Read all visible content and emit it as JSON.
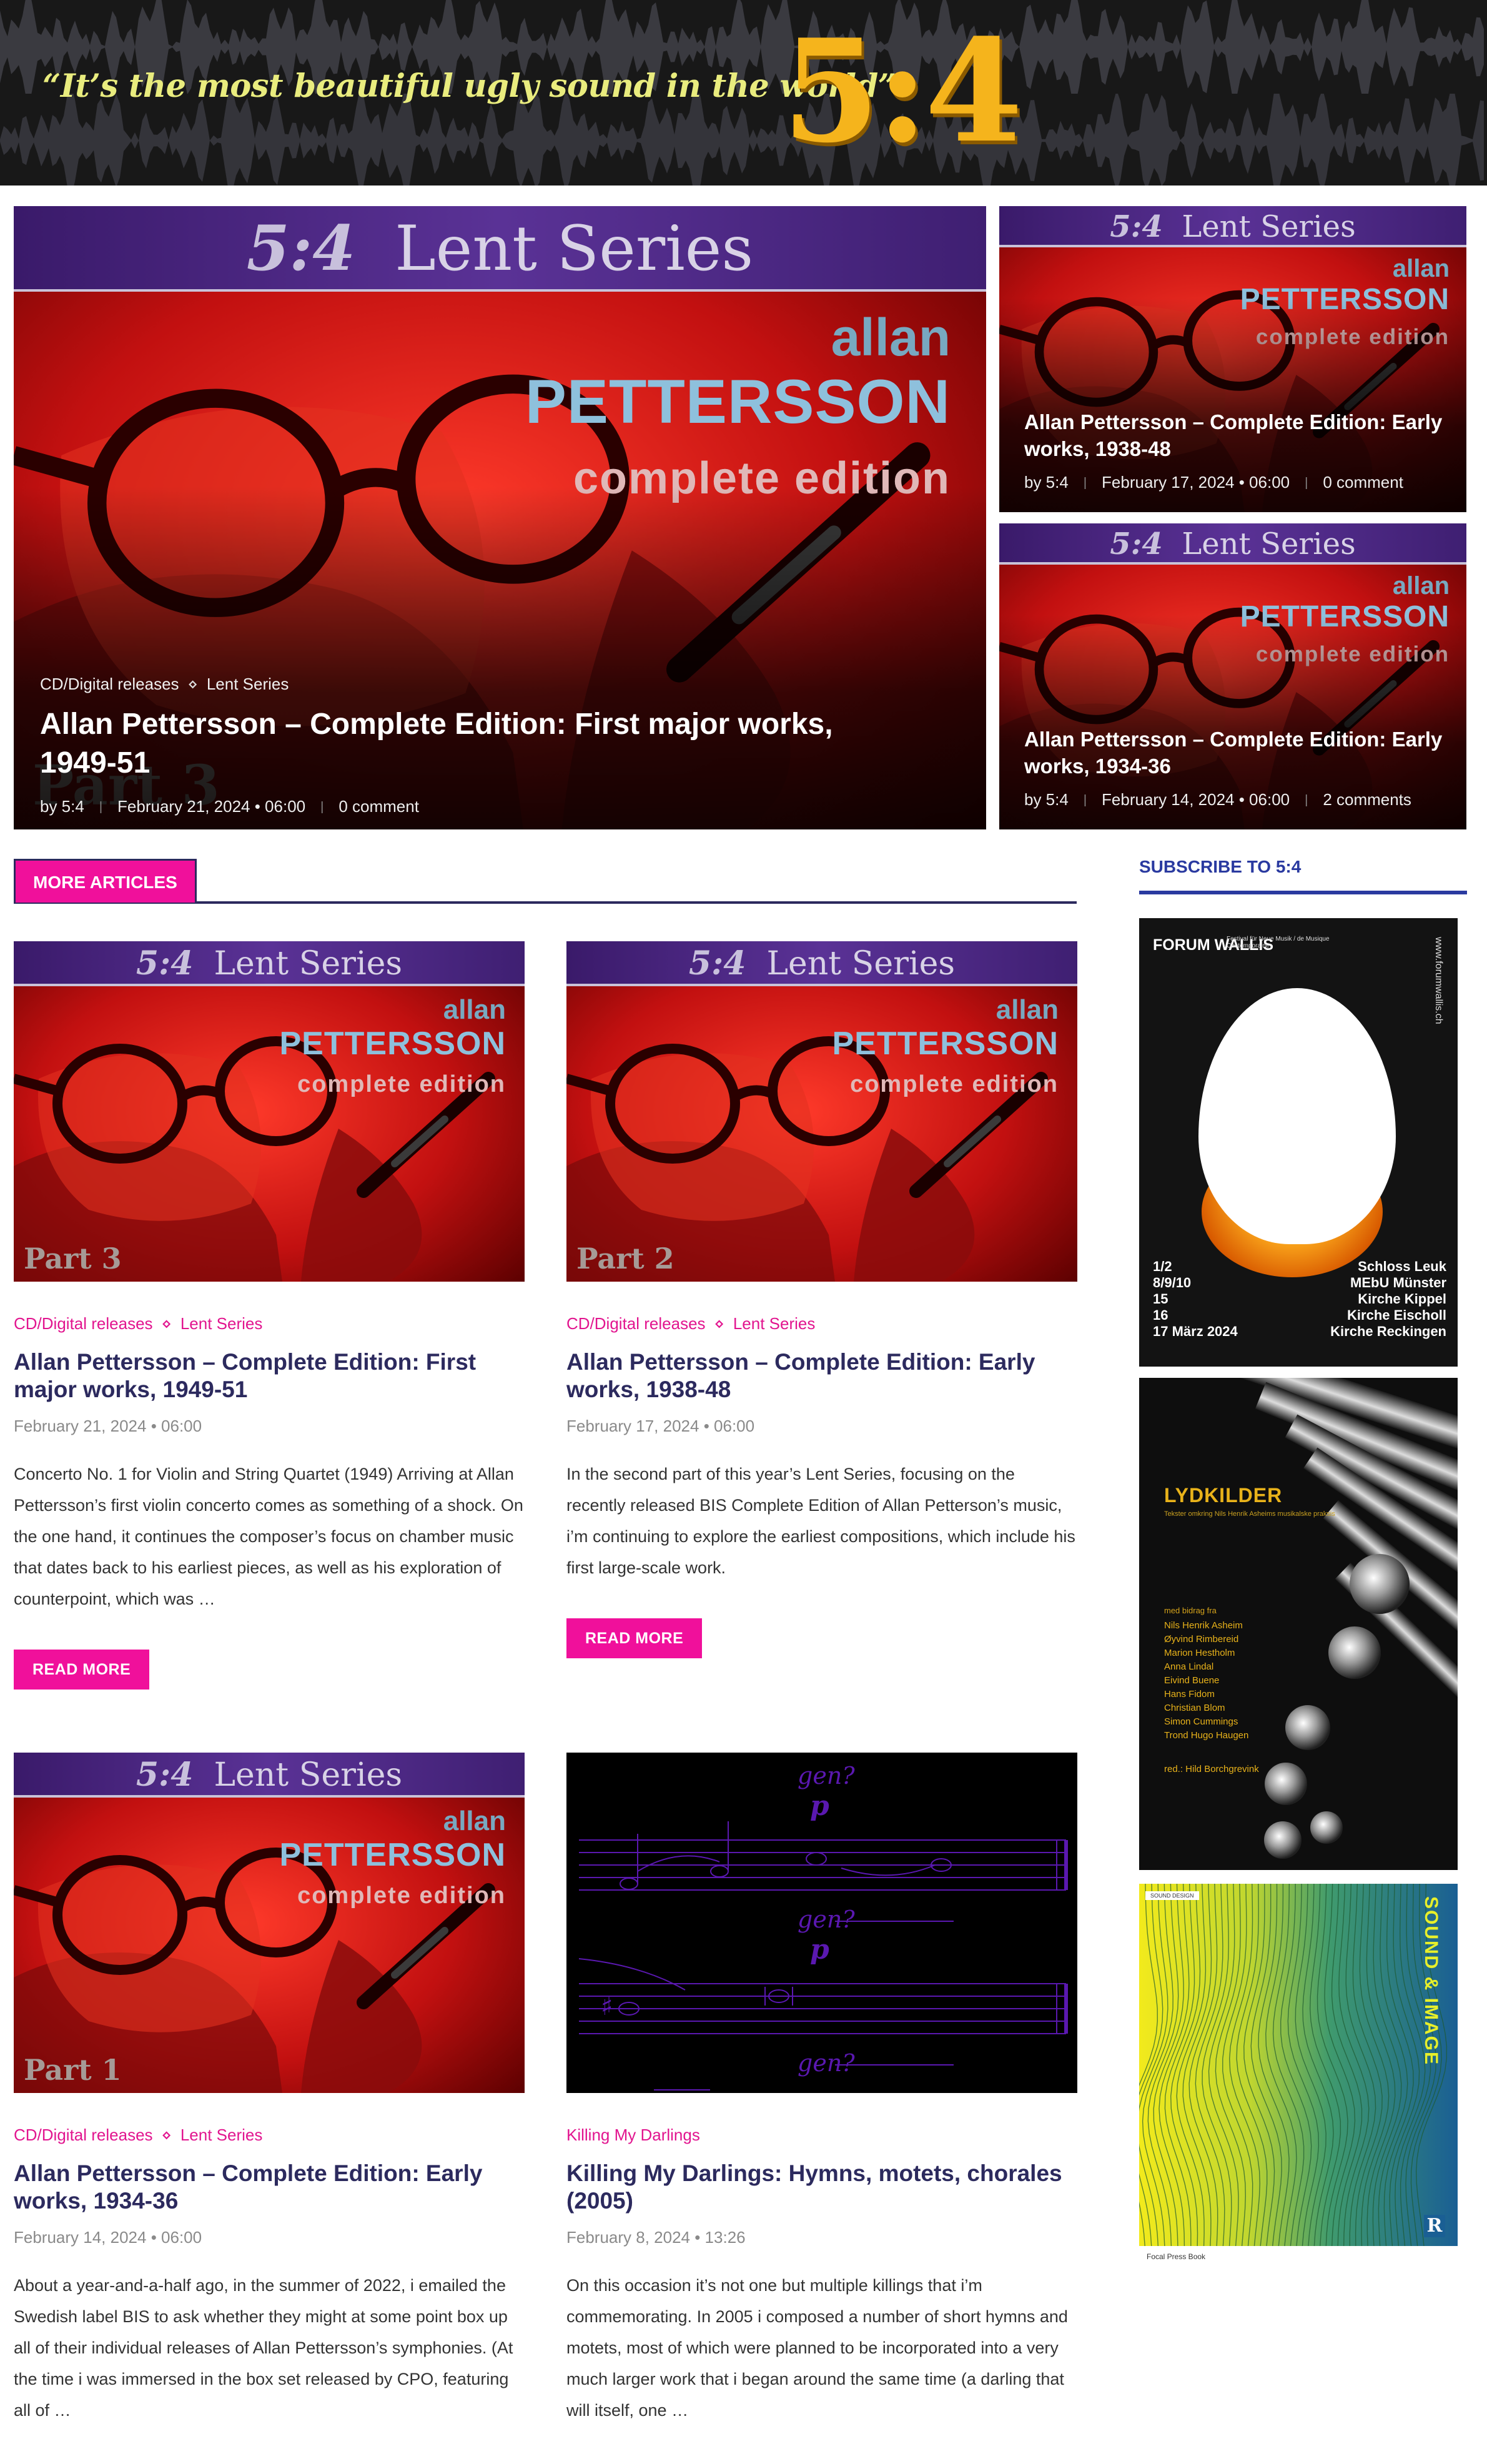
{
  "header": {
    "tagline": "“It’s the most beautiful ugly sound in the world”",
    "logo": "5:4"
  },
  "series_art": {
    "band_logo": "5:4",
    "band_label": "Lent Series",
    "allan": "allan",
    "pettersson": "PETTERSSON",
    "complete": "complete edition"
  },
  "hero": {
    "main": {
      "categories": [
        "CD/Digital releases",
        "Lent Series"
      ],
      "title": "Allan Pettersson – Complete Edition: First major works, 1949-51",
      "author": "by 5:4",
      "date": "February 21, 2024 • 06:00",
      "comments": "0 comment",
      "part_label": "Part 3"
    },
    "side": [
      {
        "title": "Allan Pettersson – Complete Edition: Early works, 1938-48",
        "author": "by 5:4",
        "date": "February 17, 2024 • 06:00",
        "comments": "0 comment"
      },
      {
        "title": "Allan Pettersson – Complete Edition: Early works, 1934-36",
        "author": "by 5:4",
        "date": "February 14, 2024 • 06:00",
        "comments": "2 comments"
      }
    ]
  },
  "more_articles": {
    "heading": "MORE ARTICLES",
    "read_more": "READ MORE",
    "articles": [
      {
        "categories": [
          "CD/Digital releases",
          "Lent Series"
        ],
        "title": "Allan Pettersson – Complete Edition: First major works, 1949-51",
        "date": "February 21, 2024 • 06:00",
        "part_label": "Part 3",
        "excerpt": "Concerto No. 1 for Violin and String Quartet (1949) Arriving at Allan Pettersson’s first violin concerto comes as something of a shock. On the one hand, it continues the composer’s focus on chamber music that dates back to his earliest pieces, as well as his exploration of counterpoint, which was …"
      },
      {
        "categories": [
          "CD/Digital releases",
          "Lent Series"
        ],
        "title": "Allan Pettersson – Complete Edition: Early works, 1938-48",
        "date": "February 17, 2024 • 06:00",
        "part_label": "Part 2",
        "excerpt": "In the second part of this year’s Lent Series, focusing on the recently released BIS Complete Edition of Allan Petterson’s music, i’m continuing to explore the earliest compositions, which include his first large-scale work."
      },
      {
        "categories": [
          "CD/Digital releases",
          "Lent Series"
        ],
        "title": "Allan Pettersson – Complete Edition: Early works, 1934-36",
        "date": "February 14, 2024 • 06:00",
        "part_label": "Part 1",
        "excerpt": "About a year-and-a-half ago, in the summer of 2022, i emailed the Swedish label BIS to ask whether they might at some point box up all of their individual releases of Allan Pettersson’s symphonies. (At the time i was immersed in the box set released by CPO, featuring all of …"
      },
      {
        "categories": [
          "Killing My Darlings"
        ],
        "title": "Killing My Darlings: Hymns, motets, chorales (2005)",
        "date": "February 8, 2024 • 13:26",
        "staff_word": "gen?",
        "excerpt": "On this occasion it’s not one but multiple killings that i’m commemorating. In 2005 i composed a number of short hymns and motets, most of which were planned to be incorporated into a very much larger work that i began around the same time (a darling that will itself, one …"
      }
    ]
  },
  "sidebar": {
    "subscribe": "SUBSCRIBE TO 5:4",
    "ads": [
      {
        "name": "forum-wallis",
        "title": "FORUM WALLIS",
        "subtitle": "Festival für Neue Musik / de Musique Contemporaine",
        "url": "www.forumwallis.ch",
        "dates": [
          "1/2",
          "8/9/10",
          "15",
          "16",
          "17 März 2024"
        ],
        "venues": [
          "Schloss Leuk",
          "MEbU Münster",
          "Kirche Kippel",
          "Kirche Eischoll",
          "Kirche Reckingen"
        ]
      },
      {
        "name": "lydkilder",
        "title": "LYDKILDER",
        "subtitle": "Tekster omkring Nils Henrik Asheims musikalske praksis",
        "contrib_label": "med bidrag fra",
        "contributors": [
          "Nils Henrik Asheim",
          "Øyvind Rimbereid",
          "Marion Hestholm",
          "Anna Lindal",
          "Eivind Buene",
          "Hans Fidom",
          "Christian Blom",
          "Simon Cummings",
          "Trond Hugo Haugen"
        ],
        "editor": "red.: Hild Borchgrevink"
      },
      {
        "name": "sound-and-image",
        "title": "SOUND & IMAGE",
        "tag": "SOUND DESIGN",
        "publisher": "Focal Press Book"
      }
    ]
  },
  "colors": {
    "accent": "#f0109b",
    "navy": "#2c2a5e",
    "logo": "#f5b41c",
    "tagline": "#e9ec7e",
    "sidebar_blue": "#2a3aa0"
  }
}
